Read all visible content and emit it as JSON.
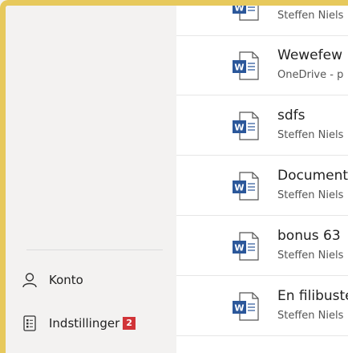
{
  "sidebar": {
    "account_label": "Konto",
    "settings_label": "Indstillinger",
    "settings_badge": "2"
  },
  "documents": [
    {
      "name": "",
      "location": "Steffen Niels"
    },
    {
      "name": "Wewefew",
      "location": "OneDrive - p"
    },
    {
      "name": "sdfs",
      "location": "Steffen Niels"
    },
    {
      "name": "Document",
      "location": "Steffen Niels"
    },
    {
      "name": "bonus 63",
      "location": "Steffen Niels"
    },
    {
      "name": "En filibuste",
      "location": "Steffen Niels"
    }
  ],
  "colors": {
    "frame": "#e7c95c",
    "word_blue": "#2b579a",
    "badge_red": "#d13438"
  },
  "icons": {
    "account": "person-icon",
    "settings": "settings-list-icon",
    "document": "word-document-icon"
  }
}
